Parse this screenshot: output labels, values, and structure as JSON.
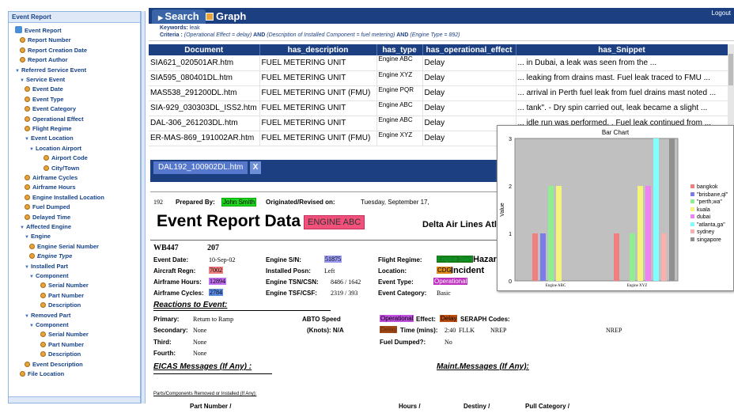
{
  "tree": {
    "header": "Event Report",
    "nodes": [
      {
        "label": "Event Report",
        "kind": "root"
      },
      {
        "label": "Report Number",
        "kind": "leaf"
      },
      {
        "label": "Report Creation Date",
        "kind": "leaf"
      },
      {
        "label": "Report Author",
        "kind": "leaf"
      },
      {
        "label": "Referred Service Event",
        "kind": "folder"
      },
      {
        "label": "Service Event",
        "kind": "folder"
      },
      {
        "label": "Event Date",
        "kind": "leaf"
      },
      {
        "label": "Event Type",
        "kind": "leaf"
      },
      {
        "label": "Event Category",
        "kind": "leaf"
      },
      {
        "label": "Operational Effect",
        "kind": "leaf"
      },
      {
        "label": "Flight Regime",
        "kind": "leaf"
      },
      {
        "label": "Event Location",
        "kind": "folder"
      },
      {
        "label": "Location Airport",
        "kind": "folder"
      },
      {
        "label": "Airport Code",
        "kind": "leaf"
      },
      {
        "label": "City/Town",
        "kind": "leaf"
      },
      {
        "label": "Airframe Cycles",
        "kind": "leaf"
      },
      {
        "label": "Airframe Hours",
        "kind": "leaf"
      },
      {
        "label": "Engine Installed Location",
        "kind": "leaf"
      },
      {
        "label": "Fuel Dumped",
        "kind": "leaf"
      },
      {
        "label": "Delayed Time",
        "kind": "leaf"
      },
      {
        "label": "Affected Engine",
        "kind": "folder"
      },
      {
        "label": "Engine",
        "kind": "folder"
      },
      {
        "label": "Engine Serial Number",
        "kind": "leaf"
      },
      {
        "label": "Engine Type",
        "kind": "leaf-italic"
      },
      {
        "label": "Installed Part",
        "kind": "folder"
      },
      {
        "label": "Component",
        "kind": "folder"
      },
      {
        "label": "Serial Number",
        "kind": "leaf"
      },
      {
        "label": "Part Number",
        "kind": "leaf"
      },
      {
        "label": "Description",
        "kind": "leaf"
      },
      {
        "label": "Removed Part",
        "kind": "folder"
      },
      {
        "label": "Component",
        "kind": "folder"
      },
      {
        "label": "Serial Number",
        "kind": "leaf"
      },
      {
        "label": "Part Number",
        "kind": "leaf"
      },
      {
        "label": "Description",
        "kind": "leaf"
      },
      {
        "label": "Event Description",
        "kind": "leaf"
      },
      {
        "label": "File Location",
        "kind": "leaf"
      }
    ]
  },
  "tabs": {
    "search": "Search",
    "graph": "Graph",
    "logout": "Logout"
  },
  "criteria": {
    "keywords_label": "Keywords:",
    "keywords": "leak",
    "criteria_label": "Criteria :",
    "c1": "(Operational Effect = delay)",
    "and1": "AND",
    "c2": "(Description of Installed Component = fuel metering)",
    "and2": "AND",
    "c3": "(Engine Type = 892)"
  },
  "grid": {
    "columns": [
      "Document",
      "has_description",
      "has_type",
      "has_operational_effect",
      "has_Snippet"
    ],
    "rows": [
      [
        "SIA621_020501AR.htm",
        "FUEL METERING UNIT",
        "Engine ABC",
        "Delay",
        "... in Dubai, a leak was seen from the ..."
      ],
      [
        "SIA595_080401DL.htm",
        "FUEL METERING UNIT",
        "Engine XYZ",
        "Delay",
        "... leaking from drains mast. Fuel leak traced to FMU ..."
      ],
      [
        "MAS538_291200DL.htm",
        "FUEL METERING UNIT (FMU)",
        "Engine PQR",
        "Delay",
        "... arrival in Perth fuel leak from fuel drains mast noted ..."
      ],
      [
        "SIA-929_030303DL_ISS2.htm",
        "FUEL METERING UNIT",
        "Engine ABC",
        "Delay",
        "... tank\". - Dry spin carried out, leak became a slight ..."
      ],
      [
        "DAL-306_261203DL.htm",
        "FUEL METERING UNIT",
        "Engine ABC",
        "Delay",
        "... idle run was performed. . Fuel leak continued from ..."
      ],
      [
        "ER-MAS-869_191002AR.htm",
        "FUEL METERING UNIT (FMU)",
        "Engine XYZ",
        "Delay",
        ""
      ]
    ]
  },
  "doc": {
    "tab": "DAL192_100902DL.htm",
    "close": "X",
    "num": "192",
    "prepared_label": "Prepared By:",
    "prepared_by": "John Smith",
    "orig_label": "Originated/Revised on:",
    "orig_date": "Tuesday, September 17,",
    "title": "Event Report Data",
    "engine_tag": "ENGINE ABC",
    "airline": "Delta Air Lines Atla",
    "wb": "WB447",
    "wb_num": "207",
    "event_date_l": "Event Date:",
    "event_date": "10-Sep-02",
    "engine_sn_l": "Engine S/N:",
    "engine_sn": "51875",
    "flight_regime_l": "Flight Regime:",
    "flight_regime": "Engine Start",
    "hazard": "Hazar",
    "regn_l": "Aircraft Regn:",
    "regn": "7002",
    "posn_l": "Installed Posn:",
    "posn": "Left",
    "location_l": "Location:",
    "location": "CDG",
    "incident": "Incident",
    "af_hours_l": "Airframe Hours:",
    "af_hours": "12894",
    "tsn_l": "Engine TSN/CSN:",
    "tsn": "8486 / 1642",
    "event_type_l": "Event Type:",
    "event_type": "Operational",
    "af_cycles_l": "Airframe Cycles:",
    "af_cycles": "2784",
    "tsf_l": "Engine TSF/CSF:",
    "tsf": "2319 / 393",
    "event_cat_l": "Event Category:",
    "event_cat": "Basic",
    "reactions": "Reactions to Event:",
    "primary_l": "Primary:",
    "primary": "Return to Ramp",
    "abto": "ABTO Speed",
    "op_effect_hl": "Operational",
    "effect_l": "Effect:",
    "effect": "Delay",
    "seraph": "SERAPH Codes:",
    "secondary_l": "Secondary:",
    "secondary": "None",
    "knots": "(Knots): N/A",
    "delay_hl": "Delay",
    "time_l": "Time (mins):",
    "time": "2:40",
    "fllk": "FLLK",
    "nrep1": "NREP",
    "nrep2": "NREP",
    "third_l": "Third:",
    "third": "None",
    "fuel_dumped_l": "Fuel Dumped?:",
    "fuel_dumped": "No",
    "fourth_l": "Fourth:",
    "fourth": "None",
    "eicas": "EICAS Messages (If Any) :",
    "maint": "Maint.Messages (If Any):",
    "parts_note": "Parts/Components Removed or Installed (If Any):",
    "col_pn": "Part Number /",
    "col_hours": "Hours /",
    "col_destiny": "Destiny /",
    "col_pull": "Pull Category /"
  },
  "chart_data": {
    "type": "bar",
    "title": "Bar Chart",
    "ylabel": "Value",
    "xlabel": "",
    "ylim": [
      0,
      3
    ],
    "yticks": [
      "0",
      "1",
      "2",
      "3"
    ],
    "categories": [
      "Engine ABC",
      "Engine XYZ"
    ],
    "series": [
      {
        "name": "bangkok",
        "color": "#f08080",
        "values": [
          1,
          1
        ]
      },
      {
        "name": "\"brisbane,ql\"",
        "color": "#7b7bea",
        "values": [
          1,
          0
        ]
      },
      {
        "name": "\"perth,wa\"",
        "color": "#90ee90",
        "values": [
          2,
          1
        ]
      },
      {
        "name": "kuala",
        "color": "#f4f47a",
        "values": [
          2,
          2
        ]
      },
      {
        "name": "dubai",
        "color": "#ee82ee",
        "values": [
          0,
          2
        ]
      },
      {
        "name": "\"atlanta,ga\"",
        "color": "#7fffff",
        "values": [
          0,
          3
        ]
      },
      {
        "name": "sydney",
        "color": "#f5b0b0",
        "values": [
          0,
          1
        ]
      },
      {
        "name": "singapore",
        "color": "#909090",
        "values": [
          0,
          3
        ]
      }
    ]
  }
}
